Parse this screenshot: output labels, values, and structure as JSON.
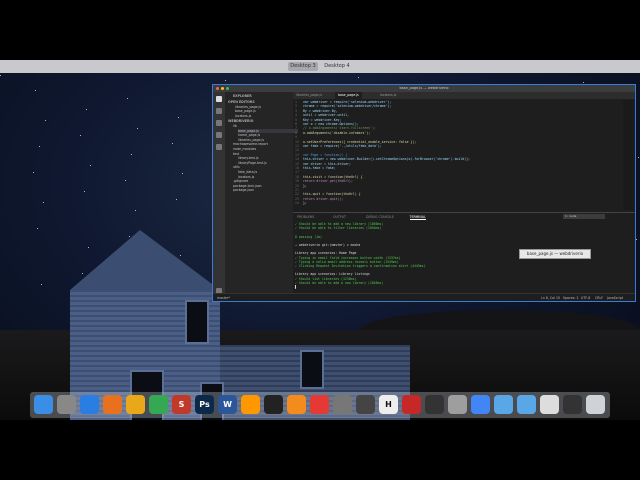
{
  "menubar": {
    "desktops": [
      "Desktop 3",
      "Desktop 4"
    ],
    "active_desktop": 0
  },
  "window": {
    "title": "base_page.js — webdriverio"
  },
  "sidebar": {
    "header": "EXPLORER",
    "open_editors_label": "OPEN EDITORS",
    "open_editors": [
      "libraries_page.js",
      "base_page.js",
      "locators.js"
    ],
    "project_label": "WEBDRIVERIO",
    "tree": [
      "lib",
      "base_page.js",
      "home_page.js",
      "libraries_page.js",
      "mochawesome-report",
      "node_modules",
      "test",
      "library.test.js",
      "libraryPage.test.js",
      "utils",
      "fake_data.js",
      "locators.js",
      ".gitignore",
      "package-lock.json",
      "package.json"
    ],
    "selected_index": 1
  },
  "tabs": [
    "libraries_page.js",
    "base_page.js",
    "locators.js"
  ],
  "active_tab": 1,
  "code_lines": [
    {
      "n": "1",
      "t": "var webdriver = require('selenium-webdriver');",
      "c": "#9cdcfe"
    },
    {
      "n": "2",
      "t": "chrome = require('selenium-webdriver/chrome');",
      "c": "#9cdcfe"
    },
    {
      "n": "3",
      "t": "By = webdriver.By,",
      "c": "#9cdcfe"
    },
    {
      "n": "4",
      "t": "until = webdriver.until,",
      "c": "#9cdcfe"
    },
    {
      "n": "5",
      "t": "Key = webdriver.Key;",
      "c": "#9cdcfe"
    },
    {
      "n": "6",
      "t": "var o = new chrome.Options();",
      "c": "#9cdcfe"
    },
    {
      "n": "7",
      "t": "// o.addArguments('start-fullscreen');",
      "c": "#6a9955"
    },
    {
      "n": "8",
      "t": "o.addArguments('disable-infobars');",
      "c": "#dcdcaa"
    },
    {
      "n": "9",
      "t": "",
      "c": "#9cdcfe"
    },
    {
      "n": "10",
      "t": "o.setUserPreferences({ credential_enable_service: false });",
      "c": "#dcdcaa"
    },
    {
      "n": "11",
      "t": "var fake = require('../utils/fake_data');",
      "c": "#9cdcfe"
    },
    {
      "n": "12",
      "t": "",
      "c": "#9cdcfe"
    },
    {
      "n": "13",
      "t": "var Page = function() {",
      "c": "#569cd6"
    },
    {
      "n": "14",
      "t": "this.driver = new webdriver.Builder().setChromeOptions(o).forBrowser('chrome').build();",
      "c": "#9cdcfe"
    },
    {
      "n": "15",
      "t": "var driver = this.driver;",
      "c": "#9cdcfe"
    },
    {
      "n": "16",
      "t": "this.fake = fake;",
      "c": "#9cdcfe"
    },
    {
      "n": "17",
      "t": "",
      "c": "#9cdcfe"
    },
    {
      "n": "18",
      "t": "this.visit = function(theUrl) {",
      "c": "#dcdcaa"
    },
    {
      "n": "19",
      "t": "return driver.get(theUrl);",
      "c": "#c586c0"
    },
    {
      "n": "20",
      "t": "};",
      "c": "#d4d4d4"
    },
    {
      "n": "21",
      "t": "",
      "c": "#9cdcfe"
    },
    {
      "n": "22",
      "t": "this.quit = function(theUrl) {",
      "c": "#dcdcaa"
    },
    {
      "n": "23",
      "t": "return driver.quit();",
      "c": "#c586c0"
    },
    {
      "n": "24",
      "t": "};",
      "c": "#d4d4d4"
    }
  ],
  "tooltip": "base_page.js — webdriverio",
  "panel": {
    "tabs": [
      "PROBLEMS",
      "OUTPUT",
      "DEBUG CONSOLE",
      "TERMINAL"
    ],
    "active": 3,
    "terminal_select": "1: node",
    "lines": [
      {
        "t": "✓ Should be able to add a new library (1860ms)",
        "c": "#4ec94e"
      },
      {
        "t": "✓ Should be able to filter libraries (1854ms)",
        "c": "#4ec94e"
      },
      {
        "t": "",
        "c": "#ccc"
      },
      {
        "t": "8 passing (1m)",
        "c": "#4ec94e"
      },
      {
        "t": "",
        "c": "#ccc"
      },
      {
        "t": "→ webdriverio git:(master) ✗ mocha",
        "c": "#ddd"
      },
      {
        "t": "",
        "c": "#ccc"
      },
      {
        "t": "Library app scenarios: Home Page",
        "c": "#ddd"
      },
      {
        "t": "✓ Typing in email field increases button width (1337ms)",
        "c": "#4ec94e"
      },
      {
        "t": "✓ Typing a valid email address reveals button (1549ms)",
        "c": "#4ec94e"
      },
      {
        "t": "✓ Clicking Request Invitation triggers a confirmation alert (4445ms)",
        "c": "#4ec94e"
      },
      {
        "t": "",
        "c": "#ccc"
      },
      {
        "t": "Library app scenarios: Library listings",
        "c": "#ddd"
      },
      {
        "t": "✓ Should list libraries (1238ms)",
        "c": "#4ec94e"
      },
      {
        "t": "✓ Should be able to add a new library (1846ms)",
        "c": "#4ec94e"
      }
    ]
  },
  "status": {
    "branch": "master*",
    "position": "Ln 8, Col 15",
    "spaces": "Spaces: 2",
    "encoding": "UTF-8",
    "eol": "CRLF",
    "language": "JavaScript"
  },
  "dock": [
    {
      "name": "finder-icon",
      "label": "",
      "color": "#3a8ee6"
    },
    {
      "name": "launchpad-icon",
      "label": "",
      "color": "#888"
    },
    {
      "name": "safari-icon",
      "label": "",
      "color": "#2a7de1"
    },
    {
      "name": "firefox-icon",
      "label": "",
      "color": "#e8711f"
    },
    {
      "name": "slack-icon",
      "label": "",
      "color": "#e9a81a"
    },
    {
      "name": "chrome-icon",
      "label": "",
      "color": "#34a853"
    },
    {
      "name": "app-icon",
      "label": "S",
      "color": "#c0392b"
    },
    {
      "name": "photoshop-icon",
      "label": "Ps",
      "color": "#0b2a4a"
    },
    {
      "name": "word-icon",
      "label": "W",
      "color": "#2b579a"
    },
    {
      "name": "sublime-icon",
      "label": "",
      "color": "#ff9800"
    },
    {
      "name": "terminal-icon",
      "label": "",
      "color": "#222"
    },
    {
      "name": "vlc-icon",
      "label": "",
      "color": "#f38b1d"
    },
    {
      "name": "calendar-icon",
      "label": "",
      "color": "#e53935"
    },
    {
      "name": "system-preferences-icon",
      "label": "",
      "color": "#777"
    },
    {
      "name": "app-icon",
      "label": "",
      "color": "#444"
    },
    {
      "name": "app-icon",
      "label": "H",
      "color": "#eee"
    },
    {
      "name": "app-icon",
      "label": "",
      "color": "#c62828"
    },
    {
      "name": "obs-icon",
      "label": "",
      "color": "#333"
    },
    {
      "name": "app-icon",
      "label": "",
      "color": "#9e9e9e"
    },
    {
      "name": "chrome-icon",
      "label": "",
      "color": "#4285f4"
    },
    {
      "name": "folder-icon",
      "label": "",
      "color": "#5aa7e8"
    },
    {
      "name": "folder-icon",
      "label": "",
      "color": "#5aa7e8"
    },
    {
      "name": "app-icon",
      "label": "",
      "color": "#ddd"
    },
    {
      "name": "app-icon",
      "label": "",
      "color": "#333"
    },
    {
      "name": "trash-icon",
      "label": "",
      "color": "#cfd2d6"
    }
  ]
}
